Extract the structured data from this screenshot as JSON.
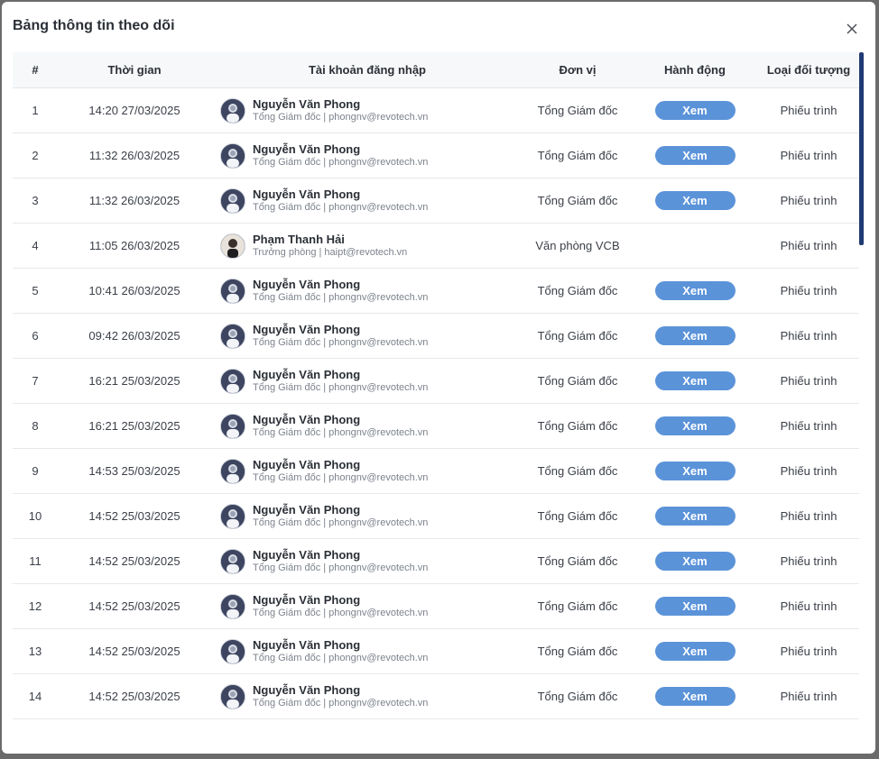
{
  "modal": {
    "title": "Bảng thông tin theo dõi",
    "close_icon": "close-icon"
  },
  "table": {
    "headers": {
      "index": "#",
      "time": "Thời gian",
      "account": "Tài khoản đăng nhập",
      "unit": "Đơn vị",
      "action": "Hành động",
      "type": "Loại đối tượng"
    },
    "rows": [
      {
        "index": "1",
        "time": "14:20 27/03/2025",
        "name": "Nguyễn Văn Phong",
        "sub": "Tổng Giám đốc | phongnv@revotech.vn",
        "unit": "Tổng Giám đốc",
        "action": "Xem",
        "type": "Phiếu trình",
        "avatar": "avatar-1"
      },
      {
        "index": "2",
        "time": "11:32 26/03/2025",
        "name": "Nguyễn Văn Phong",
        "sub": "Tổng Giám đốc | phongnv@revotech.vn",
        "unit": "Tổng Giám đốc",
        "action": "Xem",
        "type": "Phiếu trình",
        "avatar": "avatar-1"
      },
      {
        "index": "3",
        "time": "11:32 26/03/2025",
        "name": "Nguyễn Văn Phong",
        "sub": "Tổng Giám đốc | phongnv@revotech.vn",
        "unit": "Tổng Giám đốc",
        "action": "Xem",
        "type": "Phiếu trình",
        "avatar": "avatar-1"
      },
      {
        "index": "4",
        "time": "11:05 26/03/2025",
        "name": "Phạm Thanh Hải",
        "sub": "Trưởng phòng | haipt@revotech.vn",
        "unit": "Văn phòng VCB",
        "action": "",
        "type": "Phiếu trình",
        "avatar": "avatar-2"
      },
      {
        "index": "5",
        "time": "10:41 26/03/2025",
        "name": "Nguyễn Văn Phong",
        "sub": "Tổng Giám đốc | phongnv@revotech.vn",
        "unit": "Tổng Giám đốc",
        "action": "Xem",
        "type": "Phiếu trình",
        "avatar": "avatar-1"
      },
      {
        "index": "6",
        "time": "09:42 26/03/2025",
        "name": "Nguyễn Văn Phong",
        "sub": "Tổng Giám đốc | phongnv@revotech.vn",
        "unit": "Tổng Giám đốc",
        "action": "Xem",
        "type": "Phiếu trình",
        "avatar": "avatar-1"
      },
      {
        "index": "7",
        "time": "16:21 25/03/2025",
        "name": "Nguyễn Văn Phong",
        "sub": "Tổng Giám đốc | phongnv@revotech.vn",
        "unit": "Tổng Giám đốc",
        "action": "Xem",
        "type": "Phiếu trình",
        "avatar": "avatar-1"
      },
      {
        "index": "8",
        "time": "16:21 25/03/2025",
        "name": "Nguyễn Văn Phong",
        "sub": "Tổng Giám đốc | phongnv@revotech.vn",
        "unit": "Tổng Giám đốc",
        "action": "Xem",
        "type": "Phiếu trình",
        "avatar": "avatar-1"
      },
      {
        "index": "9",
        "time": "14:53 25/03/2025",
        "name": "Nguyễn Văn Phong",
        "sub": "Tổng Giám đốc | phongnv@revotech.vn",
        "unit": "Tổng Giám đốc",
        "action": "Xem",
        "type": "Phiếu trình",
        "avatar": "avatar-1"
      },
      {
        "index": "10",
        "time": "14:52 25/03/2025",
        "name": "Nguyễn Văn Phong",
        "sub": "Tổng Giám đốc | phongnv@revotech.vn",
        "unit": "Tổng Giám đốc",
        "action": "Xem",
        "type": "Phiếu trình",
        "avatar": "avatar-1"
      },
      {
        "index": "11",
        "time": "14:52 25/03/2025",
        "name": "Nguyễn Văn Phong",
        "sub": "Tổng Giám đốc | phongnv@revotech.vn",
        "unit": "Tổng Giám đốc",
        "action": "Xem",
        "type": "Phiếu trình",
        "avatar": "avatar-1"
      },
      {
        "index": "12",
        "time": "14:52 25/03/2025",
        "name": "Nguyễn Văn Phong",
        "sub": "Tổng Giám đốc | phongnv@revotech.vn",
        "unit": "Tổng Giám đốc",
        "action": "Xem",
        "type": "Phiếu trình",
        "avatar": "avatar-1"
      },
      {
        "index": "13",
        "time": "14:52 25/03/2025",
        "name": "Nguyễn Văn Phong",
        "sub": "Tổng Giám đốc | phongnv@revotech.vn",
        "unit": "Tổng Giám đốc",
        "action": "Xem",
        "type": "Phiếu trình",
        "avatar": "avatar-1"
      },
      {
        "index": "14",
        "time": "14:52 25/03/2025",
        "name": "Nguyễn Văn Phong",
        "sub": "Tổng Giám đốc | phongnv@revotech.vn",
        "unit": "Tổng Giám đốc",
        "action": "Xem",
        "type": "Phiếu trình",
        "avatar": "avatar-1"
      }
    ]
  },
  "colors": {
    "accent": "#5b93d9",
    "scrollbar": "#1f3a73"
  }
}
